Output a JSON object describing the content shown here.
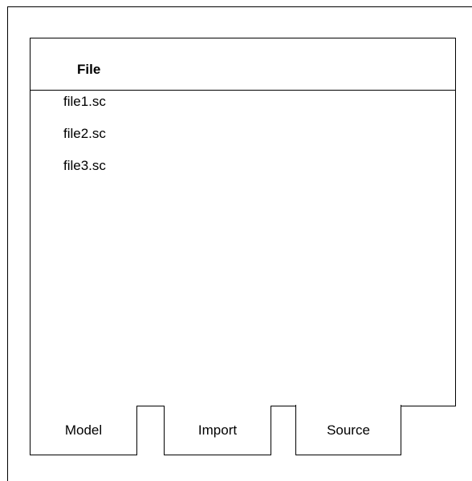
{
  "panel": {
    "title": "File",
    "files": [
      "file1.sc",
      "file2.sc",
      "file3.sc"
    ]
  },
  "tabs": [
    {
      "label": "Model",
      "active": false
    },
    {
      "label": "Import",
      "active": false
    },
    {
      "label": "Source",
      "active": true
    }
  ]
}
